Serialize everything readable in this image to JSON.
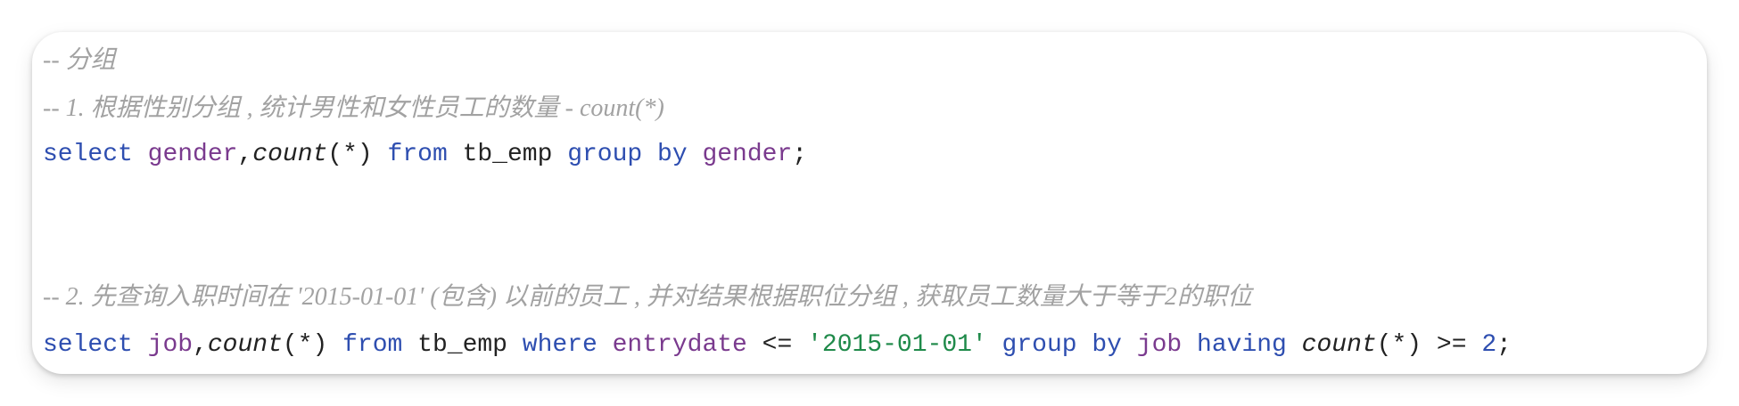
{
  "code": {
    "line1": {
      "comment": "-- 分组"
    },
    "line2": {
      "comment": "-- 1. 根据性别分组 , 统计男性和女性员工的数量 - count(*)"
    },
    "line3": {
      "select": "select",
      "col": "gender",
      "comma": ",",
      "func": "count",
      "args": "(*)",
      "from": "from",
      "table": "tb_emp",
      "group": "group",
      "by": "by",
      "groupcol": "gender",
      "end": ";"
    },
    "line4": {
      "comment": "-- 2. 先查询入职时间在 '2015-01-01' (包含) 以前的员工 , 并对结果根据职位分组 , 获取员工数量大于等于2的职位"
    },
    "line5": {
      "select": "select",
      "col": "job",
      "comma": ",",
      "func": "count",
      "args": "(*)",
      "from": "from",
      "table": "tb_emp",
      "where": "where",
      "wherecol": "entrydate",
      "op": "<=",
      "str": "'2015-01-01'",
      "group": "group",
      "by": "by",
      "groupcol": "job",
      "having": "having",
      "func2": "count",
      "args2": "(*)",
      "op2": ">=",
      "num": "2",
      "end": ";"
    }
  },
  "colors": {
    "keyword": "#2e4eb0",
    "identifier": "#7a3a8e",
    "comment": "#a2a2a2",
    "string": "#1f8a4a",
    "plain": "#222222"
  }
}
